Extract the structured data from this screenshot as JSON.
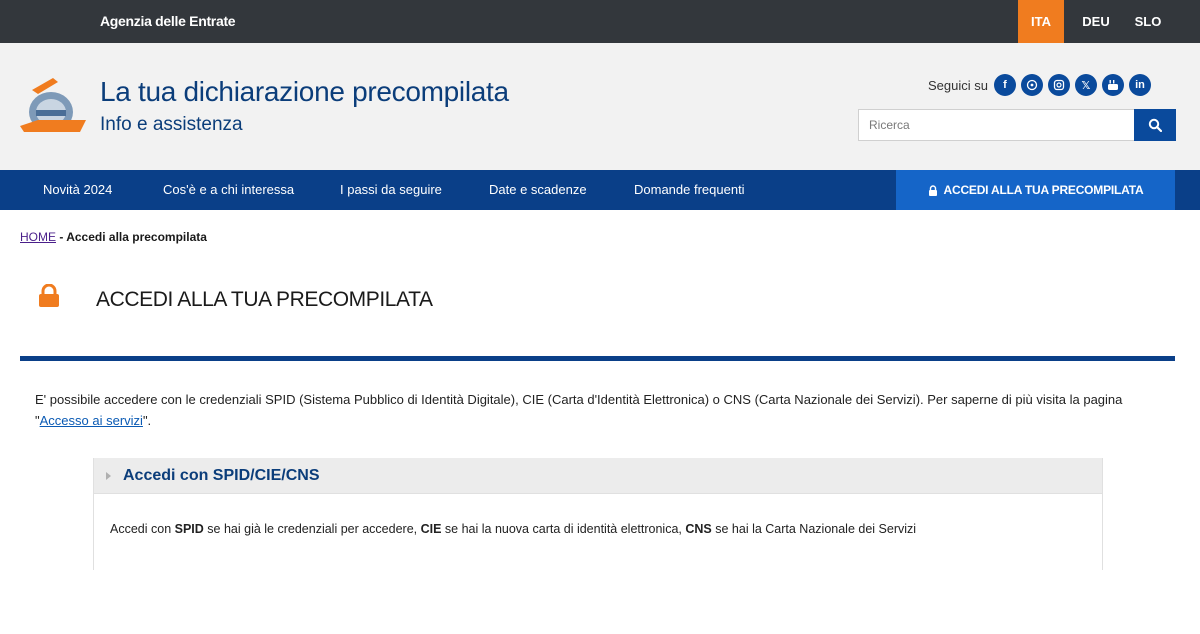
{
  "topbar": {
    "org_name": "Agenzia delle Entrate",
    "languages": [
      "ITA",
      "DEU",
      "SLO"
    ],
    "active_language_color": "#f07c1f"
  },
  "header": {
    "title": "La tua dichiarazione precompilata",
    "subtitle": "Info e assistenza",
    "follow_label": "Seguici su",
    "social_icons": [
      "facebook-icon",
      "whatsapp-icon",
      "instagram-icon",
      "x-icon",
      "youtube-icon",
      "linkedin-icon"
    ],
    "search_placeholder": "Ricerca"
  },
  "nav": {
    "items": [
      "Novità 2024",
      "Cos'è e a chi interessa",
      "I passi da seguire",
      "Date e scadenze",
      "Domande frequenti"
    ],
    "access_label": "ACCEDI ALLA TUA PRECOMPILATA"
  },
  "breadcrumb": {
    "home": "HOME",
    "current": " - Accedi alla precompilata"
  },
  "page": {
    "title": "ACCEDI ALLA TUA PRECOMPILATA",
    "intro_text": "E' possibile accedere con le credenziali SPID (Sistema Pubblico di Identità Digitale), CIE (Carta d'Identità Elettronica) o CNS (Carta Nazionale dei Servizi). Per saperne di più visita la pagina \"",
    "intro_link": "Accesso ai servizi",
    "intro_end": "\"."
  },
  "accordion": {
    "title": "Accedi con SPID/CIE/CNS",
    "body_1": "Accedi con ",
    "spid": "SPID",
    "body_2": " se hai già le credenziali per accedere, ",
    "cie": "CIE",
    "body_3": " se hai la nuova carta di identità elettronica, ",
    "cns": "CNS",
    "body_4": " se hai la Carta Nazionale dei Servizi"
  },
  "colors": {
    "topbar": "#33373c",
    "nav": "#0a3f88",
    "accent_blue": "#1565c8",
    "orange": "#f07c1f"
  }
}
